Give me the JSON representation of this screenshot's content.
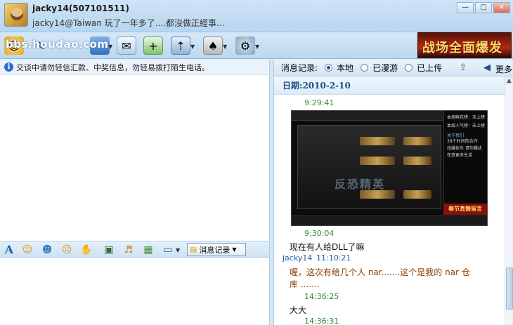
{
  "window": {
    "contact_name": "jacky14(507101511)",
    "signature": "jacky14@Taiwan 玩了一年多了....都沒做正經事...",
    "controls": [
      "—",
      "□",
      "✕"
    ]
  },
  "toolbar": {
    "watermark": "bbs.houdao.com",
    "ad_text": "战场全面爆发"
  },
  "left": {
    "warning": "交谈中请勿轻信汇款、中奖信息，勿轻易拨打陌生电话。",
    "history_button_label": "消息记录"
  },
  "right": {
    "header_label": "消息记录:",
    "options": [
      "本地",
      "已漫游",
      "已上传"
    ],
    "selected_option": "本地",
    "more_label": "更多",
    "date_label": "日期:",
    "date_value": "2010-2-10",
    "image_logo": "反恐精英",
    "image_side_lines": [
      "本周鲜花榜：未上榜",
      "本周人气榜：未上榜",
      "关于我们",
      "39个时间的合作",
      "找媒体乐 请勿骚扰",
      "任意更多生活"
    ],
    "image_red_banner": "春节真情留言"
  },
  "messages": [
    {
      "time": "9:29:41"
    },
    {
      "time": "9:30:04",
      "text": "现在有人给DLL了嘛"
    },
    {
      "sender": "jacky14",
      "time": "11:10:21",
      "text_line1": "喔，这次有给几个人 nar.......这个是我的 nar 仓",
      "text_line2": "库 ......."
    },
    {
      "time": "14:36:25",
      "text": "大大"
    },
    {
      "time": "14:36:31"
    }
  ],
  "colors": {
    "timestamp": "#2f8a3a",
    "sender": "#1d5caa",
    "self_text": "#8a3d00",
    "date": "#1d4f86"
  }
}
